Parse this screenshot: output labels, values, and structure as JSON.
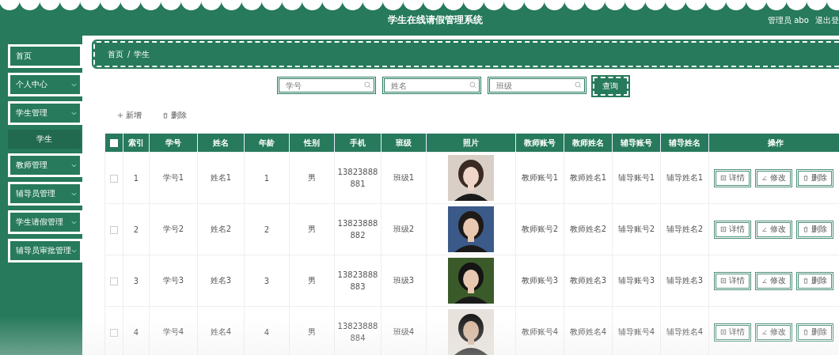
{
  "header": {
    "title": "学生在线请假管理系统",
    "user": "管理员 abo",
    "logout": "退出登"
  },
  "sidebar": {
    "items": [
      {
        "label": "首页",
        "kind": "link"
      },
      {
        "label": "个人中心",
        "kind": "group"
      },
      {
        "label": "学生管理",
        "kind": "group",
        "children": [
          {
            "label": "学生",
            "selected": true
          }
        ]
      },
      {
        "label": "教师管理",
        "kind": "group"
      },
      {
        "label": "辅导员管理",
        "kind": "group"
      },
      {
        "label": "学生请假管理",
        "kind": "group"
      },
      {
        "label": "辅导员审批管理",
        "kind": "group"
      }
    ]
  },
  "breadcrumb": {
    "items": [
      "首页",
      "学生"
    ],
    "separator": "/"
  },
  "search": {
    "fields": [
      {
        "placeholder": "学号"
      },
      {
        "placeholder": "姓名"
      },
      {
        "placeholder": "班级"
      }
    ],
    "button": "查询"
  },
  "toolbar": {
    "add": "新增",
    "delete": "删除"
  },
  "table": {
    "all_checked": false,
    "columns": [
      "索引",
      "学号",
      "姓名",
      "年龄",
      "性别",
      "手机",
      "班级",
      "照片",
      "教师账号",
      "教师姓名",
      "辅导账号",
      "辅导姓名",
      "操作"
    ],
    "rows": [
      {
        "checked": false,
        "cells": [
          "1",
          "学号1",
          "姓名1",
          "1",
          "男",
          "13823888881",
          "班级1"
        ],
        "photo": {
          "kind": "picture"
        },
        "cells2": [
          "教师账号1",
          "教师姓名1",
          "辅导账号1",
          "辅导姓名1"
        ],
        "actions": [
          "详情",
          "修改",
          "删除"
        ]
      },
      {
        "checked": false,
        "cells": [
          "2",
          "学号2",
          "姓名2",
          "2",
          "男",
          "13823888882",
          "班级2"
        ],
        "photo": {
          "kind": "picture"
        },
        "cells2": [
          "教师账号2",
          "教师姓名2",
          "辅导账号2",
          "辅导姓名2"
        ],
        "actions": [
          "详情",
          "修改",
          "删除"
        ]
      },
      {
        "checked": false,
        "cells": [
          "3",
          "学号3",
          "姓名3",
          "3",
          "男",
          "13823888883",
          "班级3"
        ],
        "photo": {
          "kind": "picture"
        },
        "cells2": [
          "教师账号3",
          "教师姓名3",
          "辅导账号3",
          "辅导姓名3"
        ],
        "actions": [
          "详情",
          "修改",
          "删除"
        ]
      },
      {
        "checked": false,
        "cells": [
          "4",
          "学号4",
          "姓名4",
          "4",
          "男",
          "13823888884",
          "班级4"
        ],
        "photo": {
          "kind": "picture"
        },
        "cells2": [
          "教师账号4",
          "教师姓名4",
          "辅导账号4",
          "辅导姓名4"
        ],
        "actions": [
          "详情",
          "修改",
          "删除"
        ]
      }
    ]
  }
}
